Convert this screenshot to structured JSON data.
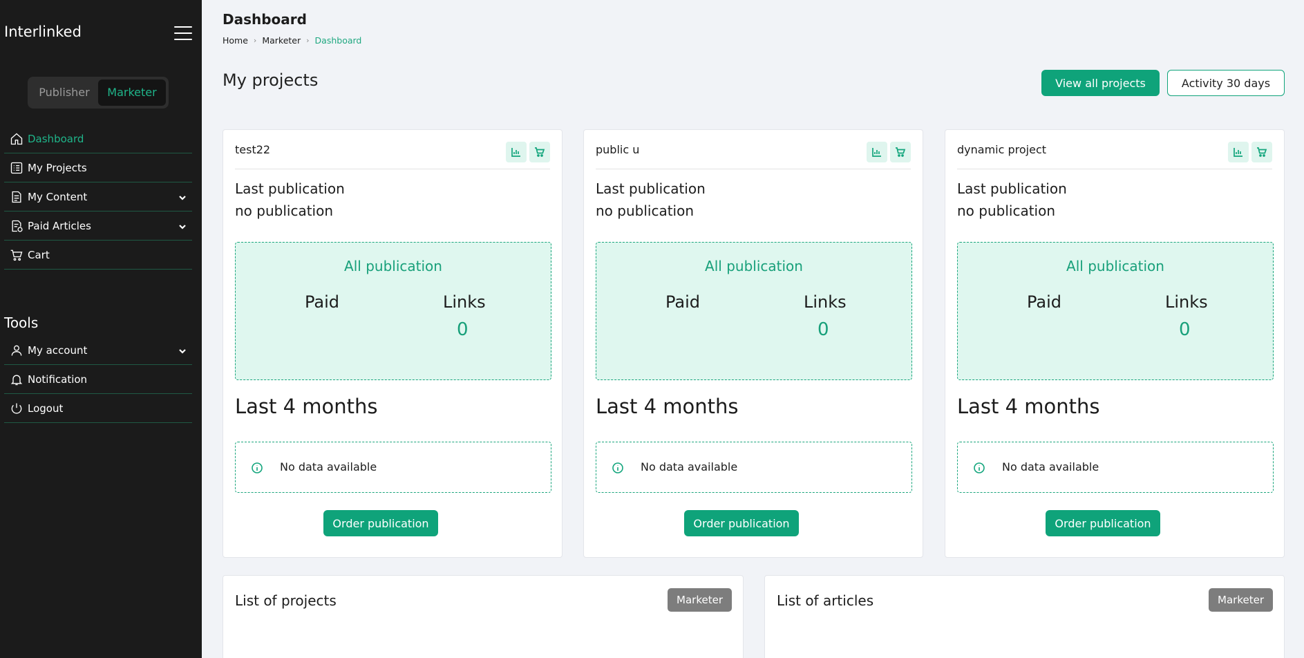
{
  "sidebar": {
    "brand": "Interlinked",
    "role_toggle": {
      "publisher": "Publisher",
      "marketer": "Marketer",
      "active": "Marketer"
    },
    "items": [
      {
        "label": "Dashboard",
        "icon": "home-icon",
        "active": true
      },
      {
        "label": "My Projects",
        "icon": "list-icon"
      },
      {
        "label": "My Content",
        "icon": "document-icon",
        "expandable": true
      },
      {
        "label": "Paid Articles",
        "icon": "paid-document-icon",
        "expandable": true
      },
      {
        "label": "Cart",
        "icon": "cart-icon"
      }
    ],
    "tools_title": "Tools",
    "tools": [
      {
        "label": "My account",
        "icon": "user-icon",
        "expandable": true
      },
      {
        "label": "Notification",
        "icon": "bell-icon"
      },
      {
        "label": "Logout",
        "icon": "power-icon"
      }
    ]
  },
  "header": {
    "title": "Dashboard",
    "breadcrumb": [
      "Home",
      "Marketer",
      "Dashboard"
    ]
  },
  "projects_section": {
    "title": "My projects",
    "view_all_label": "View all projects",
    "activity_label": "Activity 30 days"
  },
  "projects": [
    {
      "name": "test22",
      "last_publication_label": "Last publication",
      "last_publication_value": "no publication",
      "all_publication_label": "All publication",
      "paid_label": "Paid",
      "links_label": "Links",
      "links_value": "0",
      "last_months_label": "Last 4 months",
      "no_data_text": "No data available",
      "order_label": "Order publication"
    },
    {
      "name": "public u",
      "last_publication_label": "Last publication",
      "last_publication_value": "no publication",
      "all_publication_label": "All publication",
      "paid_label": "Paid",
      "links_label": "Links",
      "links_value": "0",
      "last_months_label": "Last 4 months",
      "no_data_text": "No data available",
      "order_label": "Order publication"
    },
    {
      "name": "dynamic project",
      "last_publication_label": "Last publication",
      "last_publication_value": "no publication",
      "all_publication_label": "All publication",
      "paid_label": "Paid",
      "links_label": "Links",
      "links_value": "0",
      "last_months_label": "Last 4 months",
      "no_data_text": "No data available",
      "order_label": "Order publication"
    }
  ],
  "panels": {
    "projects": {
      "title": "List of projects",
      "badge": "Marketer"
    },
    "articles": {
      "title": "List of articles",
      "badge": "Marketer"
    }
  },
  "colors": {
    "accent": "#0fa37a",
    "sidebar_bg": "#1b1b1b",
    "page_bg": "#f1f3f7"
  }
}
